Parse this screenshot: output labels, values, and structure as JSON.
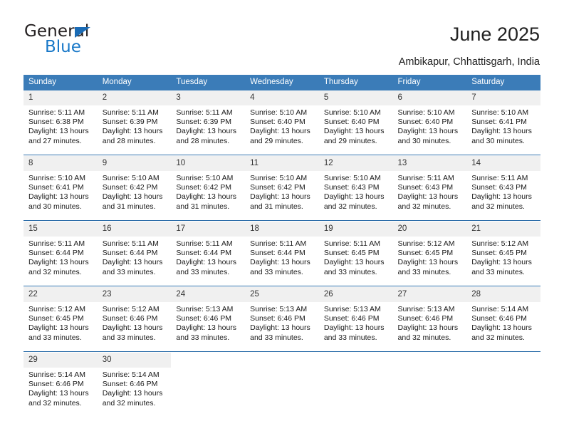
{
  "logo": {
    "primary_text": "General",
    "secondary_text": "Blue",
    "primary_color": "#231f20",
    "secondary_color": "#1878c8",
    "triangle_color": "#1a6bb5"
  },
  "header": {
    "title": "June 2025",
    "subtitle": "Ambikapur, Chhattisgarh, India"
  },
  "theme": {
    "header_blue": "#3b7cb8",
    "row_divider_blue": "#2a6ca8",
    "daynum_band": "#f0f0f0"
  },
  "calendar": {
    "weekday_headers": [
      "Sunday",
      "Monday",
      "Tuesday",
      "Wednesday",
      "Thursday",
      "Friday",
      "Saturday"
    ],
    "weeks": [
      [
        {
          "day": "1",
          "sunrise": "Sunrise: 5:11 AM",
          "sunset": "Sunset: 6:38 PM",
          "daylight": "Daylight: 13 hours and 27 minutes."
        },
        {
          "day": "2",
          "sunrise": "Sunrise: 5:11 AM",
          "sunset": "Sunset: 6:39 PM",
          "daylight": "Daylight: 13 hours and 28 minutes."
        },
        {
          "day": "3",
          "sunrise": "Sunrise: 5:11 AM",
          "sunset": "Sunset: 6:39 PM",
          "daylight": "Daylight: 13 hours and 28 minutes."
        },
        {
          "day": "4",
          "sunrise": "Sunrise: 5:10 AM",
          "sunset": "Sunset: 6:40 PM",
          "daylight": "Daylight: 13 hours and 29 minutes."
        },
        {
          "day": "5",
          "sunrise": "Sunrise: 5:10 AM",
          "sunset": "Sunset: 6:40 PM",
          "daylight": "Daylight: 13 hours and 29 minutes."
        },
        {
          "day": "6",
          "sunrise": "Sunrise: 5:10 AM",
          "sunset": "Sunset: 6:40 PM",
          "daylight": "Daylight: 13 hours and 30 minutes."
        },
        {
          "day": "7",
          "sunrise": "Sunrise: 5:10 AM",
          "sunset": "Sunset: 6:41 PM",
          "daylight": "Daylight: 13 hours and 30 minutes."
        }
      ],
      [
        {
          "day": "8",
          "sunrise": "Sunrise: 5:10 AM",
          "sunset": "Sunset: 6:41 PM",
          "daylight": "Daylight: 13 hours and 30 minutes."
        },
        {
          "day": "9",
          "sunrise": "Sunrise: 5:10 AM",
          "sunset": "Sunset: 6:42 PM",
          "daylight": "Daylight: 13 hours and 31 minutes."
        },
        {
          "day": "10",
          "sunrise": "Sunrise: 5:10 AM",
          "sunset": "Sunset: 6:42 PM",
          "daylight": "Daylight: 13 hours and 31 minutes."
        },
        {
          "day": "11",
          "sunrise": "Sunrise: 5:10 AM",
          "sunset": "Sunset: 6:42 PM",
          "daylight": "Daylight: 13 hours and 31 minutes."
        },
        {
          "day": "12",
          "sunrise": "Sunrise: 5:10 AM",
          "sunset": "Sunset: 6:43 PM",
          "daylight": "Daylight: 13 hours and 32 minutes."
        },
        {
          "day": "13",
          "sunrise": "Sunrise: 5:11 AM",
          "sunset": "Sunset: 6:43 PM",
          "daylight": "Daylight: 13 hours and 32 minutes."
        },
        {
          "day": "14",
          "sunrise": "Sunrise: 5:11 AM",
          "sunset": "Sunset: 6:43 PM",
          "daylight": "Daylight: 13 hours and 32 minutes."
        }
      ],
      [
        {
          "day": "15",
          "sunrise": "Sunrise: 5:11 AM",
          "sunset": "Sunset: 6:44 PM",
          "daylight": "Daylight: 13 hours and 32 minutes."
        },
        {
          "day": "16",
          "sunrise": "Sunrise: 5:11 AM",
          "sunset": "Sunset: 6:44 PM",
          "daylight": "Daylight: 13 hours and 33 minutes."
        },
        {
          "day": "17",
          "sunrise": "Sunrise: 5:11 AM",
          "sunset": "Sunset: 6:44 PM",
          "daylight": "Daylight: 13 hours and 33 minutes."
        },
        {
          "day": "18",
          "sunrise": "Sunrise: 5:11 AM",
          "sunset": "Sunset: 6:44 PM",
          "daylight": "Daylight: 13 hours and 33 minutes."
        },
        {
          "day": "19",
          "sunrise": "Sunrise: 5:11 AM",
          "sunset": "Sunset: 6:45 PM",
          "daylight": "Daylight: 13 hours and 33 minutes."
        },
        {
          "day": "20",
          "sunrise": "Sunrise: 5:12 AM",
          "sunset": "Sunset: 6:45 PM",
          "daylight": "Daylight: 13 hours and 33 minutes."
        },
        {
          "day": "21",
          "sunrise": "Sunrise: 5:12 AM",
          "sunset": "Sunset: 6:45 PM",
          "daylight": "Daylight: 13 hours and 33 minutes."
        }
      ],
      [
        {
          "day": "22",
          "sunrise": "Sunrise: 5:12 AM",
          "sunset": "Sunset: 6:45 PM",
          "daylight": "Daylight: 13 hours and 33 minutes."
        },
        {
          "day": "23",
          "sunrise": "Sunrise: 5:12 AM",
          "sunset": "Sunset: 6:46 PM",
          "daylight": "Daylight: 13 hours and 33 minutes."
        },
        {
          "day": "24",
          "sunrise": "Sunrise: 5:13 AM",
          "sunset": "Sunset: 6:46 PM",
          "daylight": "Daylight: 13 hours and 33 minutes."
        },
        {
          "day": "25",
          "sunrise": "Sunrise: 5:13 AM",
          "sunset": "Sunset: 6:46 PM",
          "daylight": "Daylight: 13 hours and 33 minutes."
        },
        {
          "day": "26",
          "sunrise": "Sunrise: 5:13 AM",
          "sunset": "Sunset: 6:46 PM",
          "daylight": "Daylight: 13 hours and 33 minutes."
        },
        {
          "day": "27",
          "sunrise": "Sunrise: 5:13 AM",
          "sunset": "Sunset: 6:46 PM",
          "daylight": "Daylight: 13 hours and 32 minutes."
        },
        {
          "day": "28",
          "sunrise": "Sunrise: 5:14 AM",
          "sunset": "Sunset: 6:46 PM",
          "daylight": "Daylight: 13 hours and 32 minutes."
        }
      ],
      [
        {
          "day": "29",
          "sunrise": "Sunrise: 5:14 AM",
          "sunset": "Sunset: 6:46 PM",
          "daylight": "Daylight: 13 hours and 32 minutes."
        },
        {
          "day": "30",
          "sunrise": "Sunrise: 5:14 AM",
          "sunset": "Sunset: 6:46 PM",
          "daylight": "Daylight: 13 hours and 32 minutes."
        },
        {
          "day": "",
          "sunrise": "",
          "sunset": "",
          "daylight": ""
        },
        {
          "day": "",
          "sunrise": "",
          "sunset": "",
          "daylight": ""
        },
        {
          "day": "",
          "sunrise": "",
          "sunset": "",
          "daylight": ""
        },
        {
          "day": "",
          "sunrise": "",
          "sunset": "",
          "daylight": ""
        },
        {
          "day": "",
          "sunrise": "",
          "sunset": "",
          "daylight": ""
        }
      ]
    ]
  }
}
